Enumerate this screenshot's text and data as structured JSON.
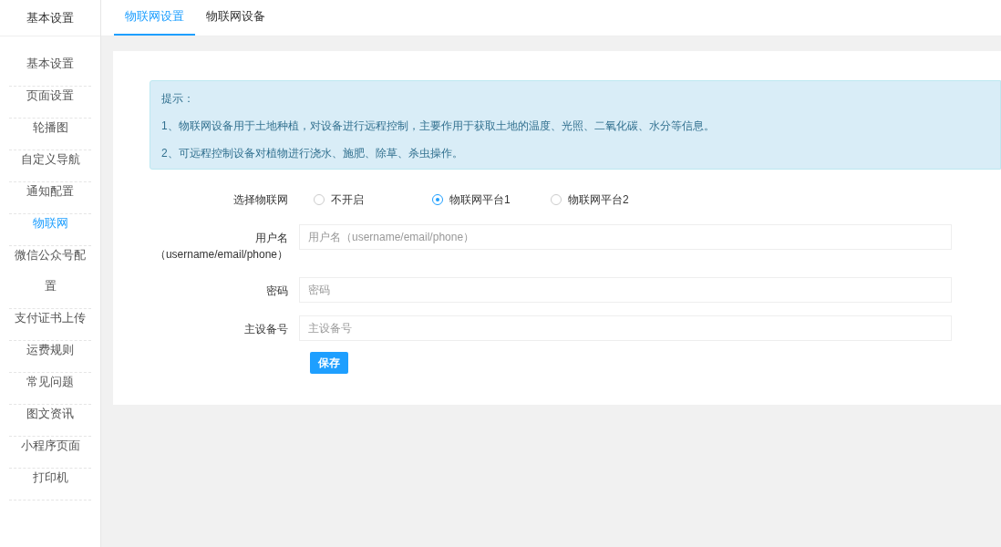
{
  "sidebar": {
    "title": "基本设置",
    "items": [
      {
        "label": "基本设置",
        "selected": false
      },
      {
        "label": "页面设置",
        "selected": false
      },
      {
        "label": "轮播图",
        "selected": false
      },
      {
        "label": "自定义导航",
        "selected": false
      },
      {
        "label": "通知配置",
        "selected": false
      },
      {
        "label": "物联网",
        "selected": true
      },
      {
        "label": "微信公众号配置",
        "selected": false
      },
      {
        "label": "支付证书上传",
        "selected": false
      },
      {
        "label": "运费规则",
        "selected": false
      },
      {
        "label": "常见问题",
        "selected": false
      },
      {
        "label": "图文资讯",
        "selected": false
      },
      {
        "label": "小程序页面",
        "selected": false
      },
      {
        "label": "打印机",
        "selected": false
      }
    ]
  },
  "tabs": [
    {
      "label": "物联网设置",
      "selected": true
    },
    {
      "label": "物联网设备",
      "selected": false
    }
  ],
  "notice": {
    "title": "提示：",
    "lines": [
      "1、物联网设备用于土地种植，对设备进行远程控制，主要作用于获取土地的温度、光照、二氧化碳、水分等信息。",
      "2、可远程控制设备对植物进行浇水、施肥、除草、杀虫操作。"
    ]
  },
  "form": {
    "platform": {
      "label": "选择物联网",
      "options": [
        {
          "label": "不开启",
          "selected": false
        },
        {
          "label": "物联网平台1",
          "selected": true
        },
        {
          "label": "物联网平台2",
          "selected": false
        }
      ]
    },
    "fields": [
      {
        "label": "用户名（username/email/phone）",
        "placeholder": "用户名（username/email/phone）"
      },
      {
        "label": "密码",
        "placeholder": "密码"
      },
      {
        "label": "主设备号",
        "placeholder": "主设备号"
      }
    ],
    "save_button": "保存"
  }
}
